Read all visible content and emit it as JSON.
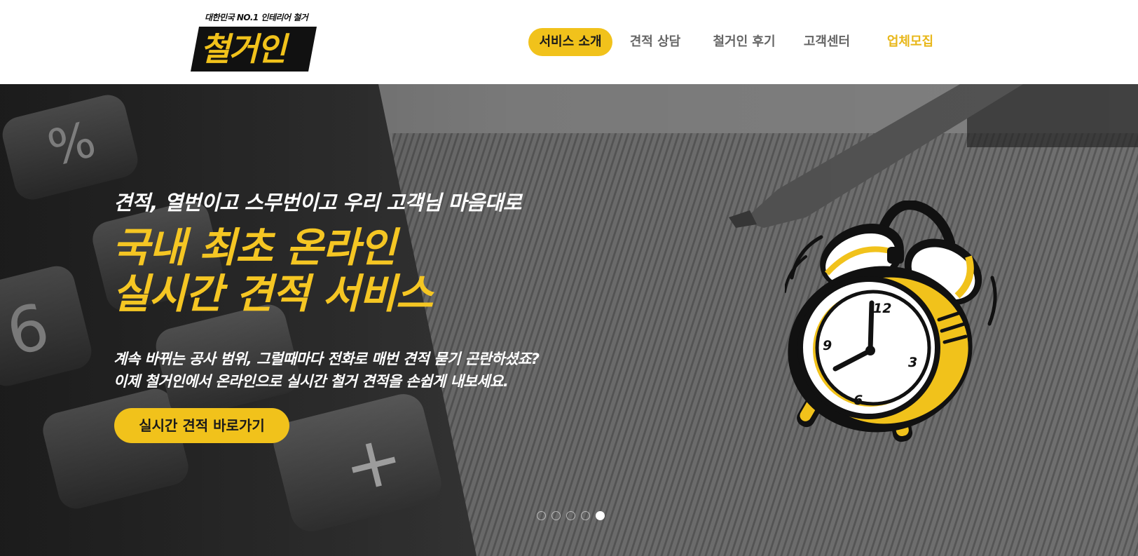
{
  "brand": {
    "tagline": "대한민국 NO.1 인테리어 철거",
    "name": "철거인",
    "colors": {
      "accent": "#f1c21b",
      "dark": "#111111"
    }
  },
  "nav": {
    "items": [
      {
        "label": "서비스 소개",
        "state": "active"
      },
      {
        "label": "견적 상담",
        "state": "normal"
      },
      {
        "label": "철거인 후기",
        "state": "normal"
      },
      {
        "label": "고객센터",
        "state": "normal"
      },
      {
        "label": "업체모집",
        "state": "highlight"
      }
    ]
  },
  "hero": {
    "sub_heading": "견적, 열번이고 스무번이고 우리 고객님 마음대로",
    "heading_line1": "국내 최초 온라인",
    "heading_line2": "실시간 견적 서비스",
    "desc_line1": "계속 바뀌는 공사 범위, 그럴때마다 전화로 매번 견적 묻기 곤란하셨죠?",
    "desc_line2": "이제 철거인에서 온라인으로 실시간 철거 견적을 손쉽게 내보세요.",
    "cta_label": "실시간 견적 바로가기",
    "clock_numbers": {
      "n12": "12",
      "n3": "3",
      "n6": "6",
      "n9": "9"
    },
    "background": "calculator-and-pen-photo"
  },
  "slider": {
    "total": 5,
    "current": 5
  }
}
